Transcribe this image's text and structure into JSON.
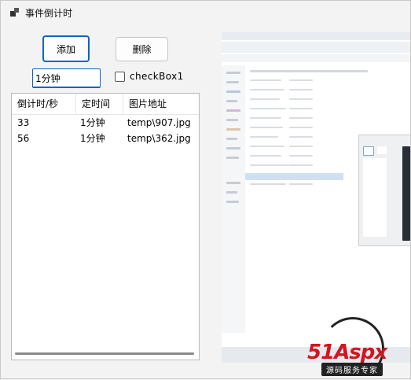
{
  "window": {
    "title": "事件倒计时"
  },
  "toolbar": {
    "add_label": "添加",
    "delete_label": "删除"
  },
  "interval_select": {
    "value": "1分钟"
  },
  "checkbox": {
    "label": "checkBox1",
    "checked": false
  },
  "listview": {
    "columns": [
      "倒计时/秒",
      "定时间",
      "图片地址"
    ],
    "rows": [
      [
        "33",
        "1分钟",
        "temp\\907.jpg"
      ],
      [
        "56",
        "1分钟",
        "temp\\362.jpg"
      ]
    ]
  },
  "watermark": {
    "logo_main": "51",
    "logo_rest": "Aspx",
    "subtitle": "源码服务专家"
  },
  "colors": {
    "accent": "#0a64c8",
    "watermark_red": "#d0161f"
  }
}
